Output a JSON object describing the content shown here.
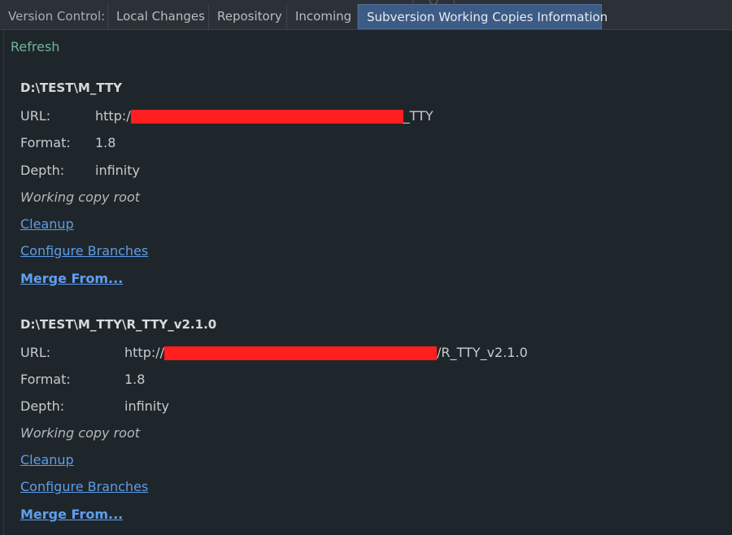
{
  "tabs": [
    {
      "label": "Version Control:"
    },
    {
      "label": "Local Changes"
    },
    {
      "label": "Repository"
    },
    {
      "label": "Incoming"
    },
    {
      "label": "Subversion Working Copies Information"
    }
  ],
  "toolbar": {
    "refresh_label": "Refresh"
  },
  "copies": [
    {
      "path": "D:\\TEST\\M_TTY",
      "url_label": "URL:",
      "url_prefix": "http:/",
      "url_suffix": "_TTY",
      "format_label": "Format:",
      "format_value": "1.8",
      "depth_label": "Depth:",
      "depth_value": "infinity",
      "root_note": "Working copy root",
      "cleanup_label": "Cleanup",
      "configure_label": "Configure Branches",
      "merge_label": "Merge From..."
    },
    {
      "path": "D:\\TEST\\M_TTY\\R_TTY_v2.1.0",
      "url_label": "URL:",
      "url_prefix": "http://",
      "url_suffix": "/R_TTY_v2.1.0",
      "format_label": "Format:",
      "format_value": "1.8",
      "depth_label": "Depth:",
      "depth_value": "infinity",
      "root_note": "Working copy root",
      "cleanup_label": "Cleanup",
      "configure_label": "Configure Branches",
      "merge_label": "Merge From..."
    }
  ],
  "colors": {
    "background": "#1f262b",
    "tab_active": "#3c5c85",
    "link": "#5c9de8",
    "refresh": "#6db59a",
    "redaction": "#ff1f1f"
  }
}
